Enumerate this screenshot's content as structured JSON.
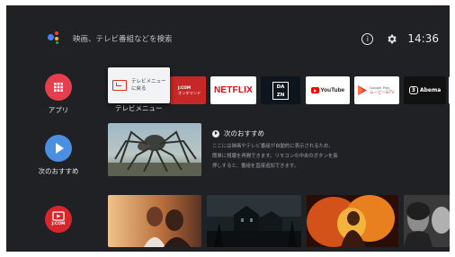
{
  "search": {
    "placeholder": "映画、テレビ番組などを検索"
  },
  "status": {
    "info_icon": "info-icon",
    "gear_icon": "gear-icon",
    "time": "14:36"
  },
  "rail": {
    "apps": {
      "label": "アプリ",
      "icon": "grid-icon",
      "color": "#e53e4d"
    },
    "next": {
      "label": "次のおすすめ",
      "icon": "play-icon",
      "color": "#4a8fe0"
    },
    "jcom": {
      "label": "J:COM",
      "icon": "jcom-logo-icon",
      "color": "#d9262d"
    }
  },
  "apps": {
    "focused": {
      "line1": "テレビメニュー",
      "line2": "に戻る",
      "caption": "テレビメニュー"
    },
    "jcom_on_demand": {
      "line1": "J:COM",
      "line2": "オンデマンド"
    },
    "netflix": "NETFLIX",
    "dazn_top": "DA",
    "dazn_bottom": "ZN",
    "youtube": "YouTube",
    "google_play_top": "Google Play",
    "google_play_bottom": "ムービー&TV",
    "abema": "Abema",
    "abema_badge": "3"
  },
  "play_next": {
    "title": "次のおすすめ",
    "desc1": "ここには映画やテレビ番組が自動的に表示されるため、",
    "desc2": "簡単に視聴を再開できます。リモコンの中央のボタンを長",
    "desc3": "押しすると、番組を直接追加できます。"
  },
  "colors": {
    "background": "#202124",
    "netflix_red": "#e50914",
    "youtube_red": "#ff0000",
    "jcom_red": "#d9262d"
  }
}
